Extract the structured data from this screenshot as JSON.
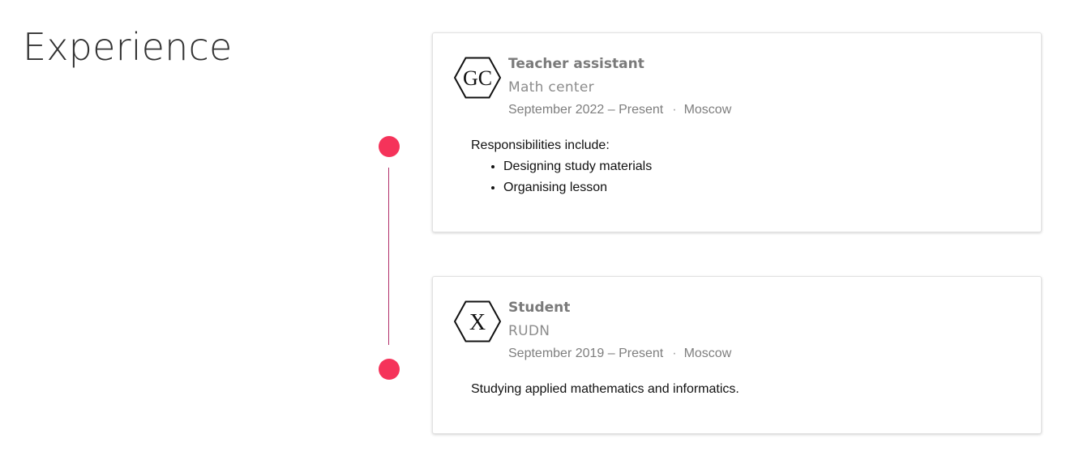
{
  "section": {
    "title": "Experience"
  },
  "colors": {
    "timeline_dot": "#f5335a",
    "timeline_line": "#b2306a",
    "title_text": "#333333",
    "muted_text": "#7a7a7a"
  },
  "experiences": [
    {
      "logo_text": "GC",
      "logo_icon": "hexagon-logo-icon",
      "title": "Teacher assistant",
      "company": "Math center",
      "dates": "September 2022 – Present",
      "separator": "·",
      "location": "Moscow",
      "intro": "Responsibilities include:",
      "bullets": [
        "Designing study materials",
        "Organising lesson"
      ]
    },
    {
      "logo_text": "X",
      "logo_icon": "hexagon-logo-icon",
      "title": "Student",
      "company": "RUDN",
      "dates": "September 2019 – Present",
      "separator": "·",
      "location": "Moscow",
      "intro": "Studying applied mathematics and informatics."
    }
  ]
}
